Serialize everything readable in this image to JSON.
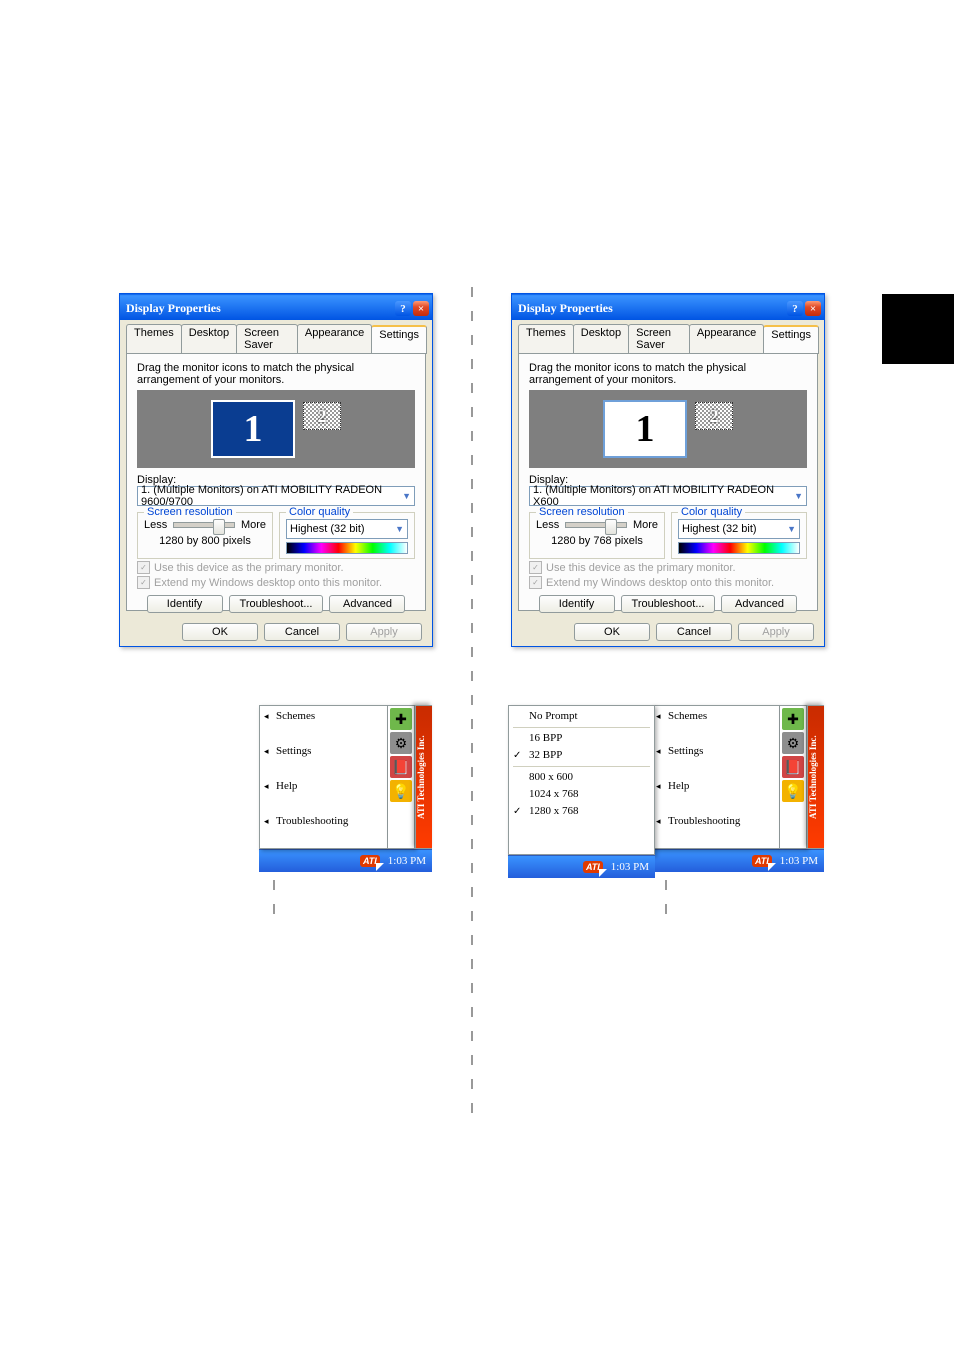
{
  "dialogs": {
    "left": {
      "title": "Display Properties",
      "tabs": [
        "Themes",
        "Desktop",
        "Screen Saver",
        "Appearance",
        "Settings"
      ],
      "active_tab": "Settings",
      "hint": "Drag the monitor icons to match the physical arrangement of your monitors.",
      "monitor1": "1",
      "monitor2": "2",
      "display_label": "Display:",
      "display_value": "1. (Multiple Monitors) on ATI MOBILITY RADEON 9600/9700",
      "screenres_legend": "Screen resolution",
      "less": "Less",
      "more": "More",
      "res_value": "1280 by 800 pixels",
      "colorq_legend": "Color quality",
      "colorq_value": "Highest (32 bit)",
      "chk1": "Use this device as the primary monitor.",
      "chk2": "Extend my Windows desktop onto this monitor.",
      "identify": "Identify",
      "troubleshoot": "Troubleshoot...",
      "advanced": "Advanced",
      "ok": "OK",
      "cancel": "Cancel",
      "apply": "Apply"
    },
    "right": {
      "title": "Display Properties",
      "tabs": [
        "Themes",
        "Desktop",
        "Screen Saver",
        "Appearance",
        "Settings"
      ],
      "active_tab": "Settings",
      "hint": "Drag the monitor icons to match the physical arrangement of your monitors.",
      "monitor1": "1",
      "monitor2": "2",
      "display_label": "Display:",
      "display_value": "1. (Multiple Monitors) on ATI MOBILITY RADEON X600",
      "screenres_legend": "Screen resolution",
      "less": "Less",
      "more": "More",
      "res_value": "1280 by 768 pixels",
      "colorq_legend": "Color quality",
      "colorq_value": "Highest (32 bit)",
      "chk1": "Use this device as the primary monitor.",
      "chk2": "Extend my Windows desktop onto this monitor.",
      "identify": "Identify",
      "troubleshoot": "Troubleshoot...",
      "advanced": "Advanced",
      "ok": "OK",
      "cancel": "Cancel",
      "apply": "Apply"
    }
  },
  "ati_menu": {
    "items": [
      "Schemes",
      "Settings",
      "Help",
      "Troubleshooting"
    ],
    "sidebar": "ATI Technologies Inc.",
    "taskbar_time": "1:03 PM",
    "tray_logo": "ATI"
  },
  "res_menu": {
    "no_prompt": "No Prompt",
    "bpp": [
      "16 BPP",
      "32 BPP"
    ],
    "bpp_checked": "32 BPP",
    "res": [
      "800 x 600",
      "1024 x 768",
      "1280 x 768"
    ],
    "res_checked": "1280 x 768",
    "taskbar_time": "1:03 PM",
    "tray_logo": "ATI"
  }
}
